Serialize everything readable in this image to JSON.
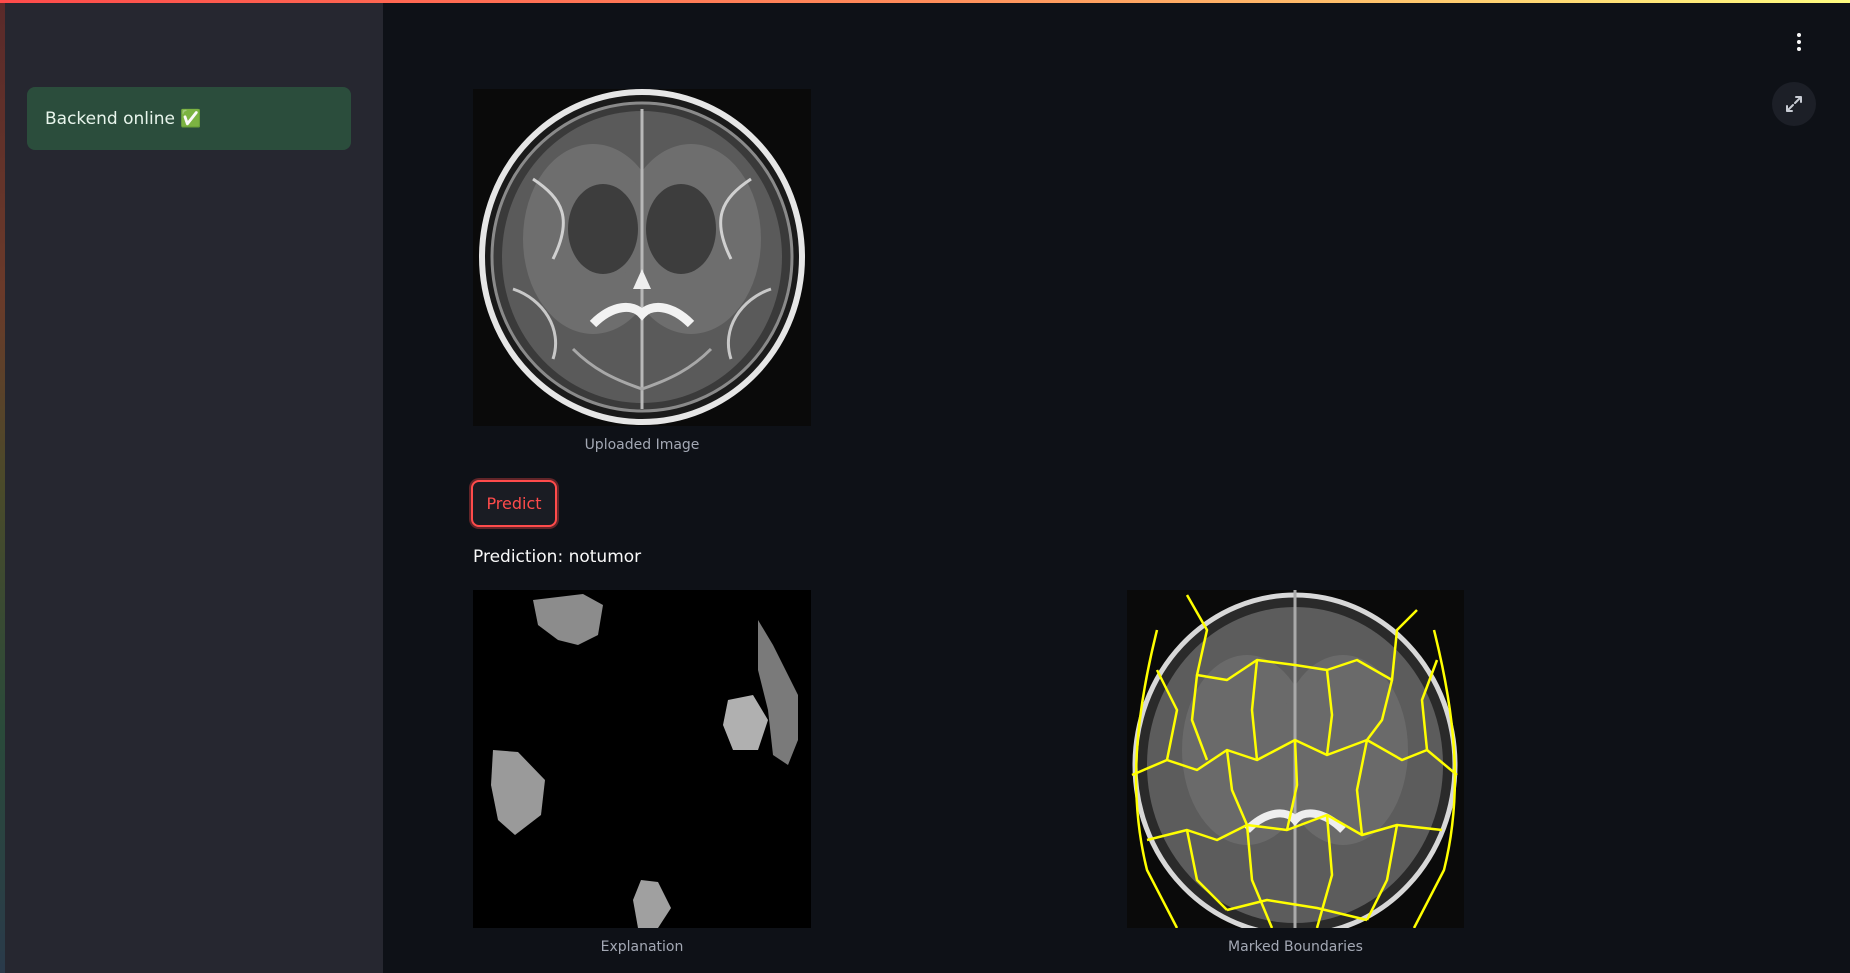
{
  "sidebar": {
    "status_text": "Backend online ✅"
  },
  "main": {
    "uploaded_caption": "Uploaded Image",
    "predict_label": "Predict",
    "prediction_text": "Prediction: notumor",
    "explanation_caption": "Explanation",
    "boundaries_caption": "Marked Boundaries"
  },
  "icons": {
    "menu": "kebab-menu-icon",
    "fullscreen": "fullscreen-icon"
  },
  "colors": {
    "background": "#0e1117",
    "sidebar": "#262730",
    "success_box": "#2b4d3c",
    "accent": "#ff4b4b",
    "boundary": "#ffff00"
  }
}
